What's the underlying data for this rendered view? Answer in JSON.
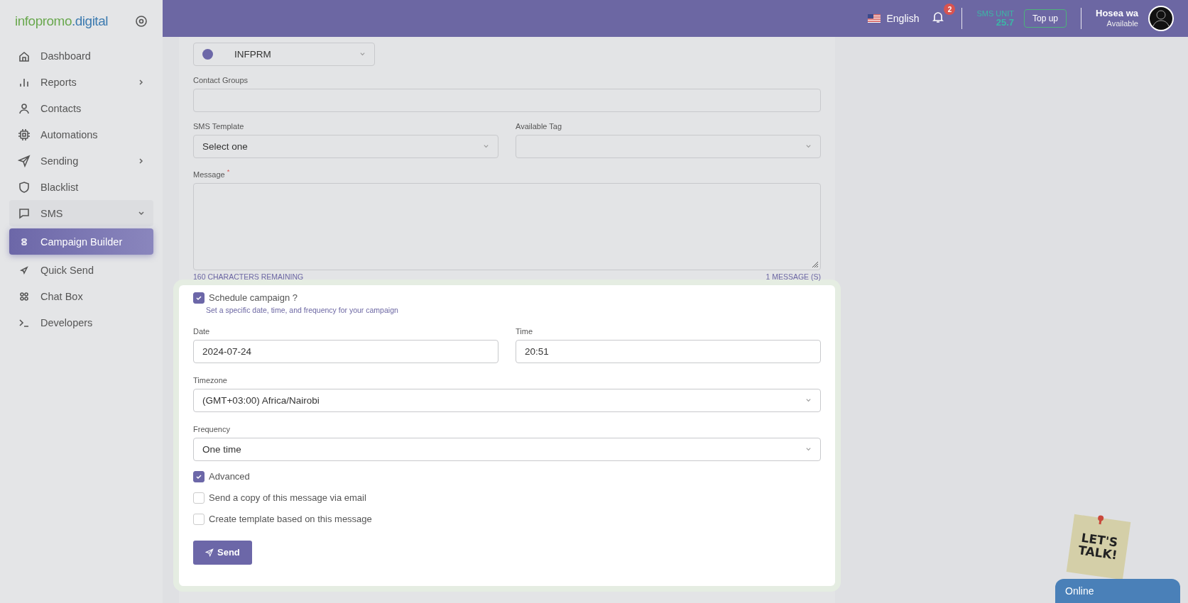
{
  "sidebar": {
    "logo": {
      "part_1": "infopromo",
      "part_2": ".digital"
    },
    "items": [
      {
        "label": "Dashboard",
        "selected": false
      },
      {
        "label": "Reports",
        "selected": false,
        "expanded": false
      },
      {
        "label": "Contacts",
        "selected": false
      },
      {
        "label": "Automations",
        "selected": false
      },
      {
        "label": "Sending",
        "selected": false,
        "expanded": false
      },
      {
        "label": "Blacklist",
        "selected": false
      },
      {
        "label": "SMS",
        "selected": false,
        "expanded": true,
        "children": [
          {
            "label": "Campaign Builder",
            "selected": true
          },
          {
            "label": "Quick Send",
            "selected": false
          },
          {
            "label": "Chat Box",
            "selected": false
          }
        ]
      },
      {
        "label": "Developers",
        "selected": false
      }
    ]
  },
  "header": {
    "language": "English",
    "notification_count": "2",
    "sms_unit_label": "SMS UNIT",
    "sms_unit_value": "25.7",
    "top_up": "Top up",
    "user_name": "Hosea wa",
    "user_status": "Available"
  },
  "form": {
    "sender": {
      "value": "INFPRM",
      "color": "#6c67a8"
    },
    "contact_groups": {
      "label": "Contact Groups"
    },
    "sms_template": {
      "label": "SMS Template",
      "value": "Select one"
    },
    "available_tag": {
      "label": "Available Tag"
    },
    "message": {
      "label": "Message",
      "required_mark": "*",
      "chars_remaining": "160 CHARACTERS REMAINING",
      "message_count": "1 MESSAGE (S)"
    },
    "schedule": {
      "label": "Schedule campaign ?",
      "checked": true,
      "hint": "Set a specific date, time, and frequency for your campaign"
    },
    "date": {
      "label": "Date",
      "value": "2024-07-24"
    },
    "time": {
      "label": "Time",
      "value": "20:51"
    },
    "timezone": {
      "label": "Timezone",
      "value": "(GMT+03:00) Africa/Nairobi"
    },
    "frequency": {
      "label": "Frequency",
      "value": "One time"
    },
    "options": [
      {
        "label": "Advanced",
        "checked": true
      },
      {
        "label": "Send a copy of this message via email",
        "checked": false
      },
      {
        "label": "Create template based on this message",
        "checked": false
      }
    ],
    "send_button": "Send"
  },
  "chat_widget": {
    "sticker_lines": [
      "LET'S",
      "TALK!"
    ],
    "status": "Online"
  }
}
